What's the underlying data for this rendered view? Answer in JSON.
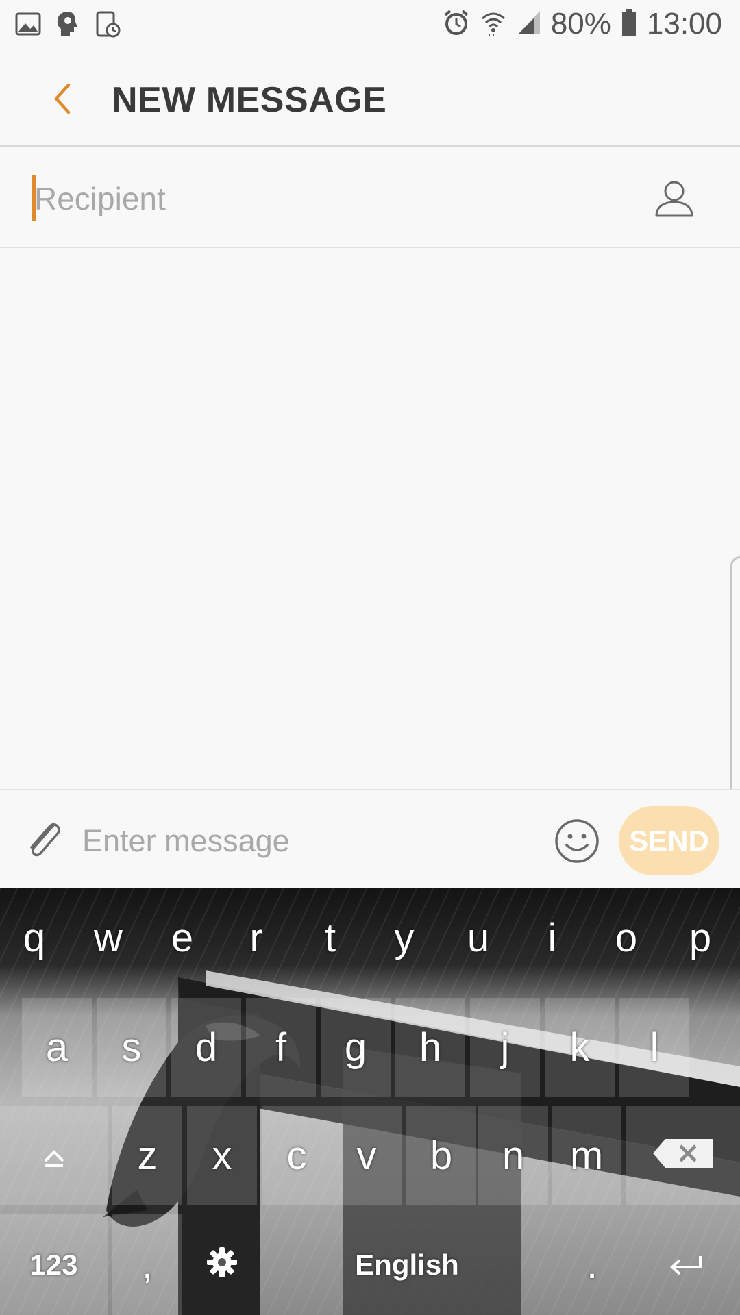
{
  "status_bar": {
    "battery": "80%",
    "time": "13:00",
    "left_icons": [
      "gallery-icon",
      "brain-icon",
      "screen-time-icon"
    ],
    "right_icons": [
      "alarm-icon",
      "wifi-icon",
      "signal-icon",
      "battery-icon"
    ]
  },
  "header": {
    "title": "NEW MESSAGE",
    "back_icon": "chevron-left-icon"
  },
  "recipient": {
    "placeholder": "Recipient",
    "value": "",
    "contact_icon": "contact-icon"
  },
  "compose": {
    "placeholder": "Enter message",
    "value": "",
    "send_label": "SEND",
    "attach_icon": "paperclip-icon",
    "emoji_icon": "smiley-icon"
  },
  "keyboard": {
    "row1": [
      "q",
      "w",
      "e",
      "r",
      "t",
      "y",
      "u",
      "i",
      "o",
      "p"
    ],
    "row2": [
      "a",
      "s",
      "d",
      "f",
      "g",
      "h",
      "j",
      "k",
      "l"
    ],
    "row3": [
      "z",
      "x",
      "c",
      "v",
      "b",
      "n",
      "m"
    ],
    "symbols_label": "123",
    "comma": ",",
    "space_label": "English",
    "period": ".",
    "shift_icon": "shift-icon",
    "backspace_icon": "backspace-icon",
    "settings_icon": "gear-icon",
    "enter_icon": "enter-icon"
  },
  "colors": {
    "accent": "#e08a2e",
    "send_disabled": "#fcdfb0",
    "background": "#f8f8f8"
  }
}
